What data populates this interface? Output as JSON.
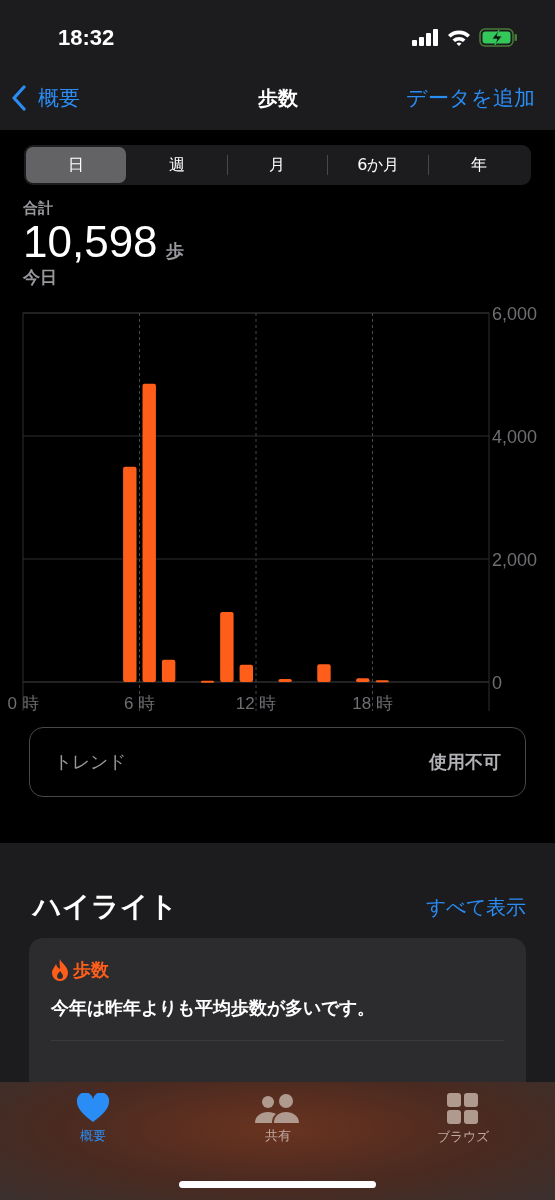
{
  "status_bar": {
    "time": "18:32"
  },
  "nav": {
    "back": "概要",
    "title": "歩数",
    "action": "データを追加"
  },
  "segments": [
    {
      "label": "日",
      "selected": true
    },
    {
      "label": "週",
      "selected": false
    },
    {
      "label": "月",
      "selected": false
    },
    {
      "label": "6か月",
      "selected": false
    },
    {
      "label": "年",
      "selected": false
    }
  ],
  "summary": {
    "label": "合計",
    "value": "10,598",
    "unit": "歩",
    "period": "今日"
  },
  "chart_data": {
    "type": "bar",
    "x": [
      0.5,
      1.5,
      2.5,
      3.5,
      4.5,
      5.5,
      6.5,
      7.5,
      8.5,
      9.5,
      10.5,
      11.5,
      12.5,
      13.5,
      14.5,
      15.5,
      16.5,
      17.5,
      18.5,
      19.5,
      20.5,
      21.5,
      22.5,
      23.5
    ],
    "xlim": [
      0,
      24
    ],
    "grid": true,
    "series": [
      {
        "color": "#ff5e1a",
        "values": [
          0,
          0,
          0,
          0,
          0,
          3500,
          4850,
          360,
          0,
          20,
          1140,
          280,
          0,
          50,
          0,
          290,
          0,
          60,
          30,
          0,
          0,
          0,
          0,
          0
        ]
      }
    ],
    "ylim": [
      0,
      6000
    ],
    "yticks": [
      0,
      {
        "value": 2000,
        "label": "2,000"
      },
      {
        "value": 4000,
        "label": "4,000"
      },
      {
        "value": 6000,
        "label": "6,000"
      }
    ],
    "xticks": [
      {
        "value": 0,
        "label": "0 時"
      },
      {
        "value": 6,
        "label": "6 時"
      },
      {
        "value": 12,
        "label": "12 時"
      },
      {
        "value": 18,
        "label": "18 時"
      }
    ]
  },
  "trend": {
    "label": "トレンド",
    "value": "使用不可"
  },
  "highlights": {
    "title": "ハイライト",
    "link": "すべて表示",
    "card": {
      "category": "歩数",
      "text": "今年は昨年よりも平均歩数が多いです。"
    }
  },
  "tab_bar": [
    {
      "kind": "heart",
      "label": "概要",
      "selected": true
    },
    {
      "kind": "people",
      "label": "共有",
      "selected": false
    },
    {
      "kind": "grid",
      "label": "ブラウズ",
      "selected": false
    }
  ]
}
